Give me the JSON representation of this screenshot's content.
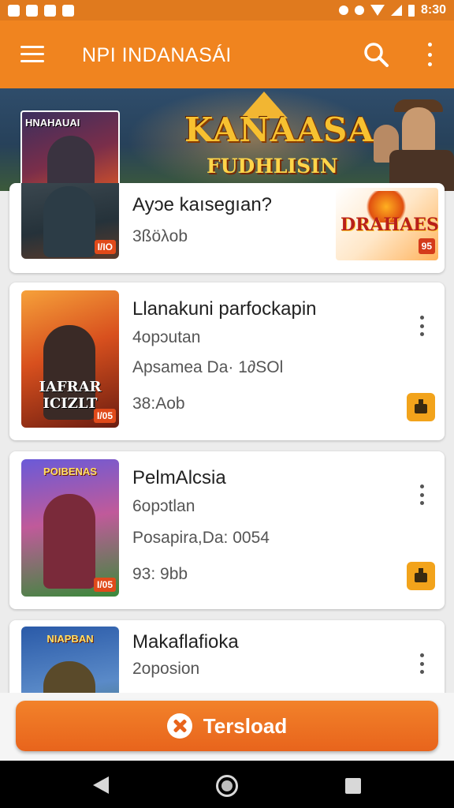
{
  "status_bar": {
    "time": "8:30"
  },
  "app_bar": {
    "title": "NPI INDANASÁI",
    "menu_icon": "hamburger-menu-icon",
    "search_icon": "search-icon",
    "more_icon": "more-vert-icon"
  },
  "banner": {
    "poster_title": "HNAHAUAI",
    "title": "KANAASA",
    "subtitle": "FUDHLISIN"
  },
  "cards": [
    {
      "title": "Ayɔe kaısegıan?",
      "line1": "3ßöλob",
      "age": "I/IO",
      "promo_title": "DRAHAES",
      "promo_age": "95"
    },
    {
      "title": "Llanakuni parfockapin",
      "line1": "4opɔutan",
      "line2": "Apsamea Da· 1∂SOl",
      "line3": "38:Aob",
      "age": "I/05",
      "poster_title": "IAFRAR",
      "poster_sub": "ICIZLT"
    },
    {
      "title": "PelmAlcsia",
      "line1": "6opɔtlan",
      "line2": "Posapira,Da: 0054",
      "line3": "93: 9bb",
      "age": "I/05",
      "poster_title": "POIBENAS"
    },
    {
      "title": "Makaflafioka",
      "line1": "2oposion",
      "poster_title": "NIAPBAN"
    }
  ],
  "download_button": {
    "label": "Tersload",
    "icon": "close-badge-icon"
  },
  "colors": {
    "primary": "#f0841f",
    "status_bar": "#e07a1e",
    "badge": "#f2a31b",
    "button": "#e8641c"
  }
}
